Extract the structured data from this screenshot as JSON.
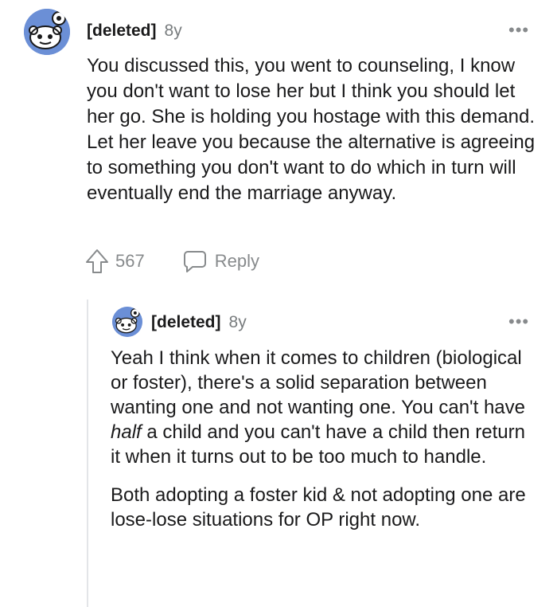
{
  "comment": {
    "author": "[deleted]",
    "age": "8y",
    "more_label": "•••",
    "body": "You discussed this, you went to counseling, I know you don't want to lose her but I think you should let her go. She is holding you hostage with this demand. Let her leave you because the alternative is agreeing to something you don't want to do which in turn will eventually end the marriage anyway.",
    "votes": "567",
    "reply_label": "Reply",
    "avatar_icon": "reddit-snoo-avatar-icon"
  },
  "reply": {
    "author": "[deleted]",
    "age": "8y",
    "more_label": "•••",
    "para1_part1": "Yeah I think when it comes to children (biological or foster), there's a solid separation between wanting one and not wanting one. You can't have ",
    "para1_emphasis": "half",
    "para1_part2": " a child and you can't have a child then return it when it turns out to be too much to handle.",
    "para2": "Both adopting a foster kid & not adopting one are lose-lose situations for OP right now.",
    "avatar_icon": "reddit-snoo-avatar-icon"
  },
  "colors": {
    "avatar_bg": "#6b8fd6",
    "meta_gray": "#787c7e",
    "icon_gray": "#878a8c",
    "thread_line": "#e3e5e8"
  }
}
